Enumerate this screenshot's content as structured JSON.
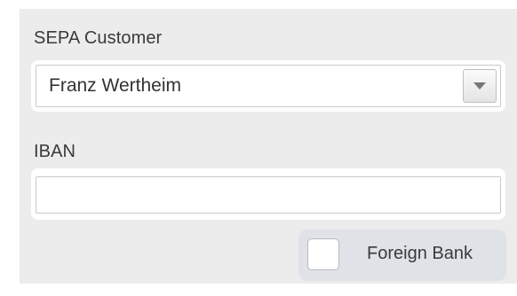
{
  "form": {
    "sepa_customer": {
      "label": "SEPA Customer",
      "selected_value": "Franz Wertheim",
      "dropdown_icon": "chevron-down-icon"
    },
    "iban": {
      "label": "IBAN",
      "value": ""
    },
    "foreign_bank": {
      "label": "Foreign Bank",
      "checked": false
    }
  },
  "colors": {
    "panel_background": "#ececec",
    "checkbox_group_background": "#dfe3e8",
    "text": "#3a3a3a",
    "border": "#c9c9c9"
  }
}
